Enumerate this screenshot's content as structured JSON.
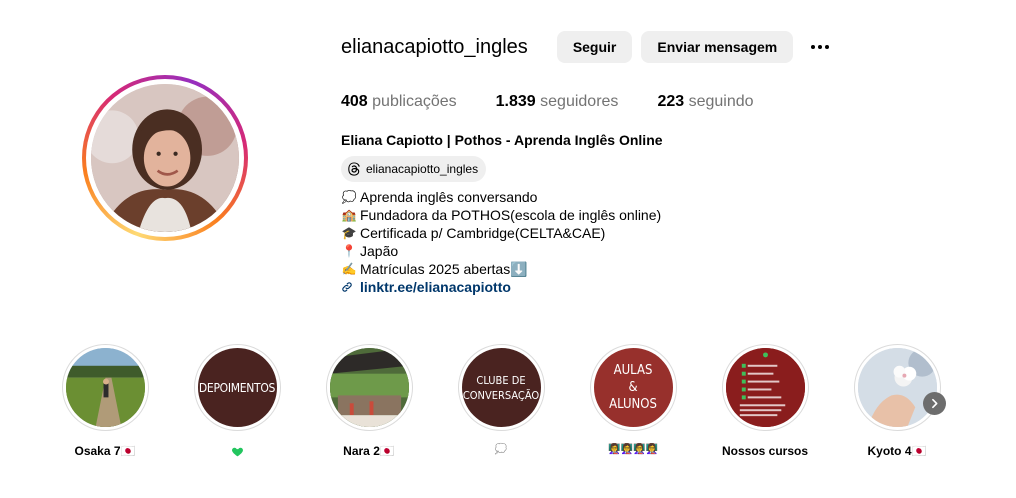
{
  "profile": {
    "username": "elianacapiotto_ingles",
    "follow_label": "Seguir",
    "message_label": "Enviar mensagem",
    "more_icon": "more-horizontal-icon"
  },
  "stats": {
    "posts_count": "408",
    "posts_label": "publicações",
    "followers_count": "1.839",
    "followers_label": "seguidores",
    "following_count": "223",
    "following_label": "seguindo"
  },
  "bio": {
    "full_name": "Eliana Capiotto | Pothos - Aprenda Inglês Online",
    "threads_handle": "elianacapiotto_ingles",
    "lines": [
      {
        "emoji": "💭",
        "text": "Aprenda inglês conversando"
      },
      {
        "emoji": "🏫",
        "text": "Fundadora da POTHOS(escola de inglês online)"
      },
      {
        "emoji": "🎓",
        "text": "Certificada p/ Cambridge(CELTA&CAE)"
      },
      {
        "emoji": "📍",
        "text": "Japão"
      },
      {
        "emoji": "✍️",
        "text": " Matrículas 2025 abertas⬇️"
      }
    ],
    "link": "linktr.ee/elianacapiotto"
  },
  "highlights": [
    {
      "label": "Osaka 7🇯🇵",
      "cover_text": ""
    },
    {
      "label": "💚",
      "cover_text": "DEPOIMENTOS"
    },
    {
      "label": "Nara 2🇯🇵",
      "cover_text": ""
    },
    {
      "label": "💭",
      "cover_text": "CLUBE DE CONVERSAÇÃO"
    },
    {
      "label": "👩‍🏫👩‍🏫👩‍🏫👩‍🏫",
      "cover_text": "AULAS & ALUNOS"
    },
    {
      "label": "Nossos cursos",
      "cover_text": ""
    },
    {
      "label": "Kyoto 4🇯🇵",
      "cover_text": ""
    }
  ],
  "colors": {
    "button_bg": "#efefef",
    "secondary_text": "#737373",
    "link": "#00376b",
    "highlight_dark": "#4a2320"
  }
}
